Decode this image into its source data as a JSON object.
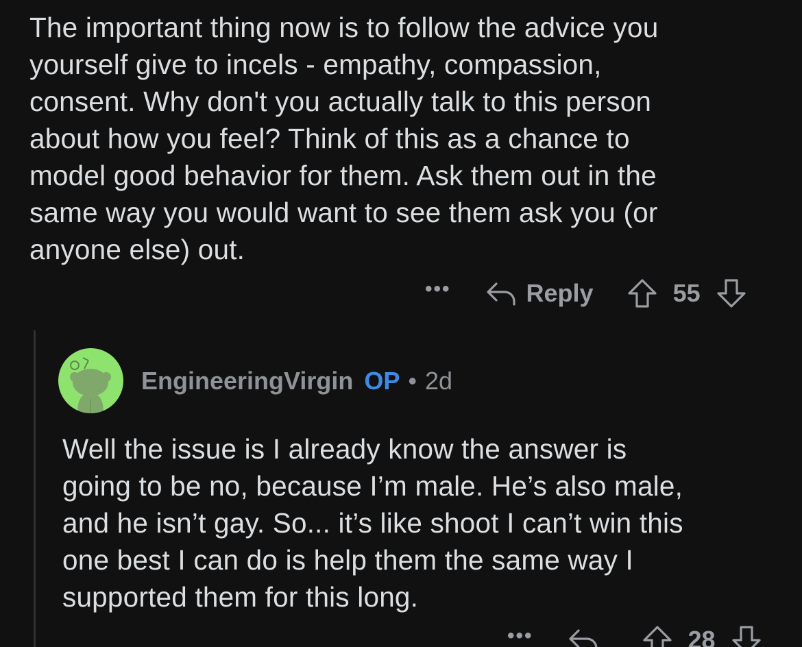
{
  "parent_comment": {
    "body_lines": [
      "The important thing now is to follow the advice you",
      "yourself give to incels - empathy, compassion,",
      "consent. Why don't you actually talk to this person",
      "about how you feel? Think of this as a chance to",
      "model good behavior for them. Ask them out in the",
      "same way you would want to see them ask you (or",
      "anyone else) out."
    ],
    "actions": {
      "more_label": "•••",
      "reply_label": "Reply",
      "score": "55"
    }
  },
  "reply_comment": {
    "username": "EngineeringVirgin",
    "op_badge": "OP",
    "separator": "•",
    "age": "2d",
    "body_lines": [
      "Well the issue is I already know the answer is",
      "going to be no, because I’m male. He’s also male,",
      "and he isn’t gay. So... it’s like shoot I can’t win this",
      "one best I can do is help them the same way I",
      "supported them for this long."
    ],
    "actions": {
      "more_label": "•••",
      "score": "28"
    }
  },
  "colors": {
    "background": "#111112",
    "text": "#dcdfe1",
    "muted": "#9a9da1",
    "op_accent": "#3d8be6",
    "avatar_bg": "#8ee36e"
  },
  "icons": {
    "reply": "reply-arrow-icon",
    "upvote": "upvote-arrow-icon",
    "downvote": "downvote-arrow-icon",
    "avatar": "snoo-avatar-icon"
  }
}
